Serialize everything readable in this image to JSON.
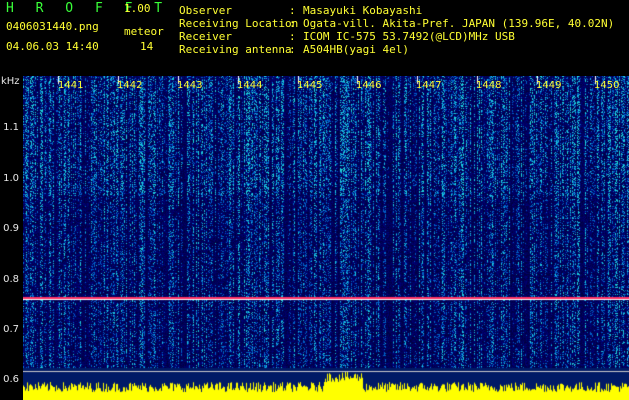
{
  "header": {
    "app_logo": "H R O F F T",
    "version": "1.00",
    "filename": "0406031440.png",
    "meteor_label": "meteor",
    "meteor_count": "14",
    "datetime": "04.06.03 14:40"
  },
  "info": [
    {
      "key": "Observer",
      "value": "Masayuki Kobayashi"
    },
    {
      "key": "Receiving Location",
      "value": "Ogata-vill. Akita-Pref. JAPAN (139.96E, 40.02N)"
    },
    {
      "key": "Receiver",
      "value": "ICOM IC-575 53.7492(@LCD)MHz USB"
    },
    {
      "key": "Receiving antenna",
      "value": "A504HB(yagi 4el)"
    }
  ],
  "axis": {
    "unit": "kHz",
    "freq_labels": [
      "1.1",
      "1.0",
      "0.9",
      "0.8",
      "0.7",
      "0.6"
    ],
    "minute_labels": [
      "1441",
      "1442",
      "1443",
      "1444",
      "1445",
      "1446",
      "1447",
      "1448",
      "1449",
      "1450"
    ]
  },
  "colors": {
    "background": "#000000",
    "text": "#ffff33",
    "logo": "#39ff39",
    "spectrum_base": "#001a66",
    "carrier": "#ff3366",
    "amplitude": "#ffff00"
  }
}
